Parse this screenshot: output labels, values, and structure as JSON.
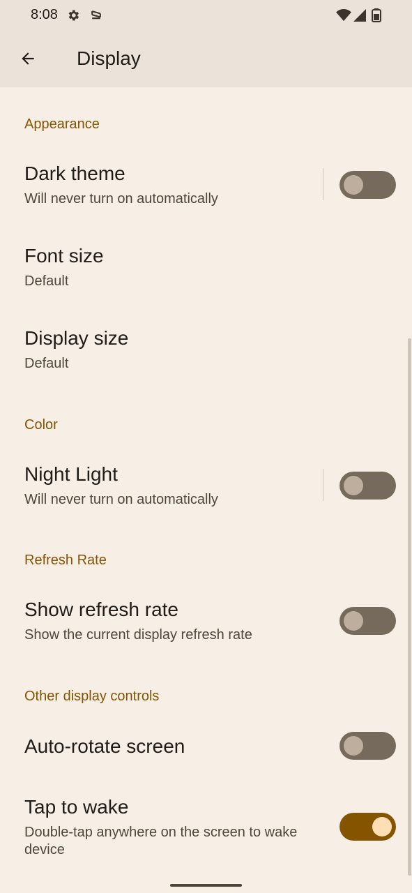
{
  "status_bar": {
    "time": "8:08",
    "icons": [
      "gear-icon",
      "shield-icon",
      "wifi-icon",
      "signal-icon",
      "battery-icon"
    ]
  },
  "app_bar": {
    "title": "Display",
    "back_icon": "arrow-back-icon"
  },
  "colors": {
    "background": "#f7efe6",
    "app_bar": "#ebe3d9",
    "accent": "#845400",
    "switch_off_track": "#766a5c",
    "switch_on_track": "#855400"
  },
  "sections": {
    "appearance": {
      "header": "Appearance",
      "dark_theme": {
        "title": "Dark theme",
        "summary": "Will never turn on automatically",
        "checked": false
      },
      "font_size": {
        "title": "Font size",
        "summary": "Default"
      },
      "display_size": {
        "title": "Display size",
        "summary": "Default"
      }
    },
    "color": {
      "header": "Color",
      "night_light": {
        "title": "Night Light",
        "summary": "Will never turn on automatically",
        "checked": false
      }
    },
    "refresh_rate": {
      "header": "Refresh Rate",
      "show_refresh_rate": {
        "title": "Show refresh rate",
        "summary": "Show the current display refresh rate",
        "checked": false
      }
    },
    "other": {
      "header": "Other display controls",
      "auto_rotate": {
        "title": "Auto-rotate screen",
        "checked": false
      },
      "tap_to_wake": {
        "title": "Tap to wake",
        "summary": "Double-tap anywhere on the screen to wake device",
        "checked": true
      }
    }
  }
}
